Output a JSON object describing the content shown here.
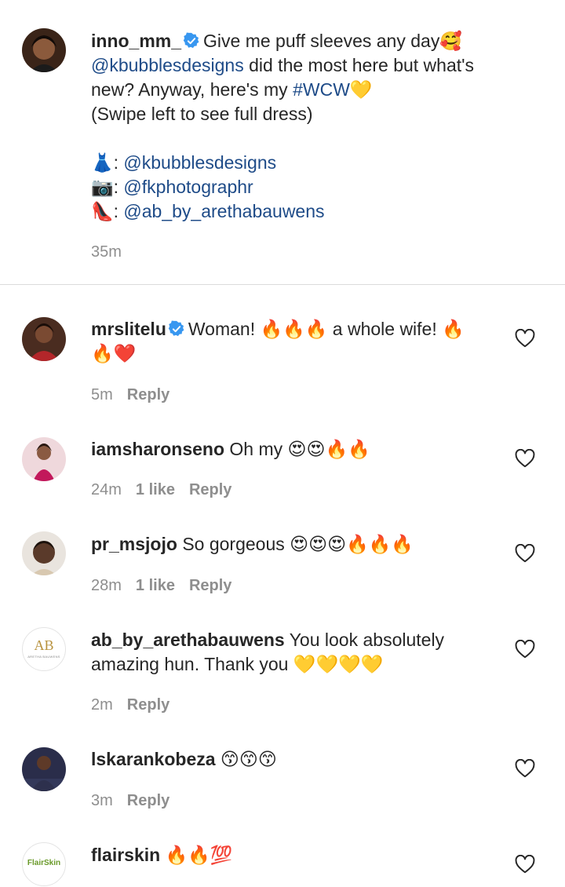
{
  "caption": {
    "username": "inno_mm_",
    "line1": "Give me puff sleeves any day🥰",
    "mention1": "@kbubblesdesigns",
    "line2_rest": " did the most here but what's",
    "line3": "new? Anyway, here's my ",
    "hashtag": "#WCW",
    "hashtag_emoji": "💛",
    "line4": "(Swipe left to see full dress)",
    "credit_dress_icon": "👗",
    "credit_dress": "@kbubblesdesigns",
    "credit_camera_icon": "📷",
    "credit_camera": "@fkphotographr",
    "credit_shoe_icon": "👠",
    "credit_shoe": "@ab_by_arethabauwens",
    "time": "35m"
  },
  "comments": [
    {
      "username": "mrslitelu",
      "text_a": "Woman! 🔥🔥🔥 a whole wife! 🔥",
      "text_b": "🔥❤️",
      "time": "5m",
      "likes": "",
      "reply": "Reply"
    },
    {
      "username": "iamsharonseno",
      "text_a": "Oh my 😍😍🔥🔥",
      "time": "24m",
      "likes": "1 like",
      "reply": "Reply"
    },
    {
      "username": "pr_msjojo",
      "text_a": "So gorgeous 😍😍😍🔥🔥🔥",
      "time": "28m",
      "likes": "1 like",
      "reply": "Reply"
    },
    {
      "username": "ab_by_arethabauwens",
      "text_a": "You look absolutely",
      "text_b": "amazing hun. Thank you 💛💛💛💛",
      "avatar_logo": "AB",
      "avatar_sub": "ARETHA BAUWENS",
      "time": "2m",
      "reply": "Reply"
    },
    {
      "username": "lskarankobeza",
      "text_a": "😙😙😙",
      "time": "3m",
      "reply": "Reply"
    },
    {
      "username": "flairskin",
      "text_a": "🔥🔥💯",
      "avatar_logo": "FlairSkin"
    }
  ],
  "colors": {
    "text": "#262626",
    "muted": "#8e8e8e",
    "link": "#1e4b88",
    "verified": "#3897f0",
    "divider": "#dbdbdb"
  },
  "icons": [
    "verified-badge-icon",
    "heart-icon"
  ]
}
